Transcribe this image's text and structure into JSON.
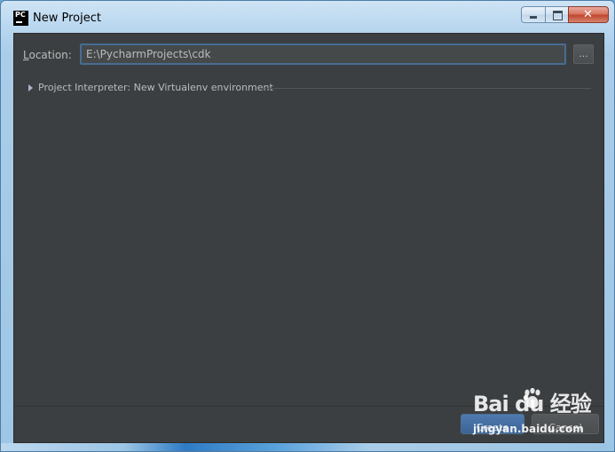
{
  "window": {
    "title": "New Project",
    "icon_text": "PC",
    "close_glyph": "✕"
  },
  "location": {
    "label_mnemonic": "L",
    "label_rest": "ocation:",
    "value": "E:\\PycharmProjects\\cdk",
    "browse_label": "..."
  },
  "interpreter": {
    "label": "Project Interpreter: New Virtualenv environment"
  },
  "buttons": {
    "create_label": "Create",
    "cancel_label": "Cancel"
  },
  "watermark": {
    "brand": "Bai  du 经验",
    "url": "jingyan.baidu.com"
  },
  "colors": {
    "dialog_background": "#3c3f41",
    "text": "#bbbbbb",
    "focus_border": "#466d94",
    "primary_button": "#4a6fa0"
  }
}
